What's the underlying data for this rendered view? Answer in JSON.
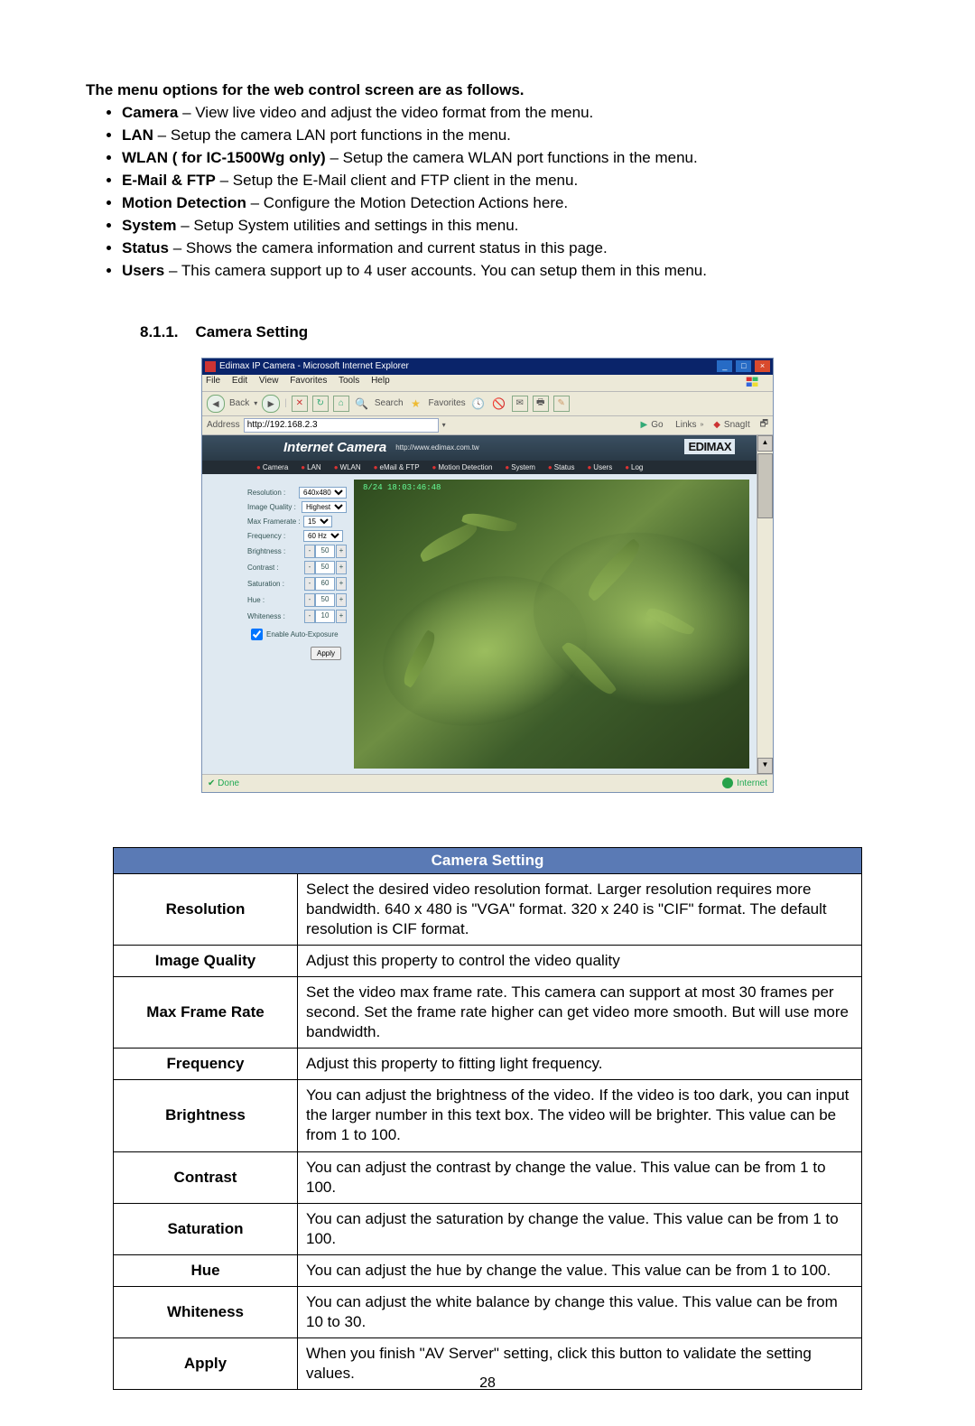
{
  "intro_heading": "The menu options for the web control screen are as follows.",
  "menu_items": [
    {
      "name": "Camera",
      "desc": " – View live video and adjust the video format from the menu."
    },
    {
      "name": "LAN",
      "desc": " – Setup the camera LAN port functions in the menu."
    },
    {
      "name": "WLAN ( for IC-1500Wg only)",
      "desc": " – Setup the camera WLAN port functions in the menu."
    },
    {
      "name": "E-Mail & FTP",
      "desc": " – Setup the E-Mail client and FTP client in the menu."
    },
    {
      "name": "Motion Detection",
      "desc": " – Configure the Motion Detection Actions here."
    },
    {
      "name": "System",
      "desc": " – Setup System utilities and settings in this menu."
    },
    {
      "name": "Status",
      "desc": " – Shows the camera information and current status in this page."
    },
    {
      "name": "Users",
      "desc": " – This camera support up to 4 user accounts. You can setup them in this menu."
    }
  ],
  "section_number": "8.1.1.",
  "section_title": "Camera Setting",
  "ie": {
    "title": "Edimax IP Camera - Microsoft Internet Explorer",
    "menus": [
      "File",
      "Edit",
      "View",
      "Favorites",
      "Tools",
      "Help"
    ],
    "toolbar": {
      "back": "Back",
      "search": "Search",
      "favorites": "Favorites"
    },
    "addr_label": "Address",
    "addr_value": "http://192.168.2.3",
    "go": "Go",
    "links": "Links",
    "snagit": "SnagIt",
    "status_done": "Done",
    "status_zone": "Internet"
  },
  "cam_page": {
    "banner": "Internet Camera",
    "banner_sub": "http://www.edimax.com.tw",
    "brand": "EDIMAX",
    "tabs": [
      "Camera",
      "LAN",
      "WLAN",
      "eMail & FTP",
      "Motion Detection",
      "System",
      "Status",
      "Users",
      "Log"
    ],
    "fields": {
      "resolution": {
        "label": "Resolution :",
        "value": "640x480"
      },
      "image_quality": {
        "label": "Image Quality :",
        "value": "Highest"
      },
      "max_framerate": {
        "label": "Max Framerate :",
        "value": "15"
      },
      "frequency": {
        "label": "Frequency :",
        "value": "60 Hz"
      },
      "brightness": {
        "label": "Brightness :",
        "value": "50"
      },
      "contrast": {
        "label": "Contrast :",
        "value": "50"
      },
      "saturation": {
        "label": "Saturation :",
        "value": "60"
      },
      "hue": {
        "label": "Hue :",
        "value": "50"
      },
      "whiteness": {
        "label": "Whiteness :",
        "value": "10"
      },
      "auto_exposure": "Enable Auto-Exposure",
      "apply": "Apply"
    },
    "osd": "8/24 18:03:46:48"
  },
  "table": {
    "header": "Camera Setting",
    "rows": [
      {
        "k": "Resolution",
        "v": "Select the desired video resolution format. Larger resolution requires more bandwidth. 640 x 480 is \"VGA\" format. 320 x 240 is \"CIF\" format. The default resolution is CIF format."
      },
      {
        "k": "Image Quality",
        "v": "Adjust this property to control the video quality"
      },
      {
        "k": "Max Frame Rate",
        "v": "Set the video max frame rate. This camera can support at most 30 frames per second. Set the frame rate higher can get video more smooth. But will use more bandwidth."
      },
      {
        "k": "Frequency",
        "v": "Adjust this property to fitting light frequency."
      },
      {
        "k": "Brightness",
        "v": "You can adjust the brightness of the video. If the video is too dark, you can input the larger number in this text box. The video will be brighter. This value can be from 1 to 100."
      },
      {
        "k": "Contrast",
        "v": "You can adjust the contrast by change the value. This value can be from 1 to 100."
      },
      {
        "k": "Saturation",
        "v": "You can adjust the saturation by change the value. This value can be from 1 to 100."
      },
      {
        "k": "Hue",
        "v": "You can adjust the hue by change the value. This value can be from 1 to 100."
      },
      {
        "k": "Whiteness",
        "v": "You can adjust the white balance by change this value.    This value can be from 10 to 30."
      },
      {
        "k": "Apply",
        "v": "When you finish \"AV Server\" setting, click this button to validate the setting values."
      }
    ]
  },
  "page_number": "28"
}
